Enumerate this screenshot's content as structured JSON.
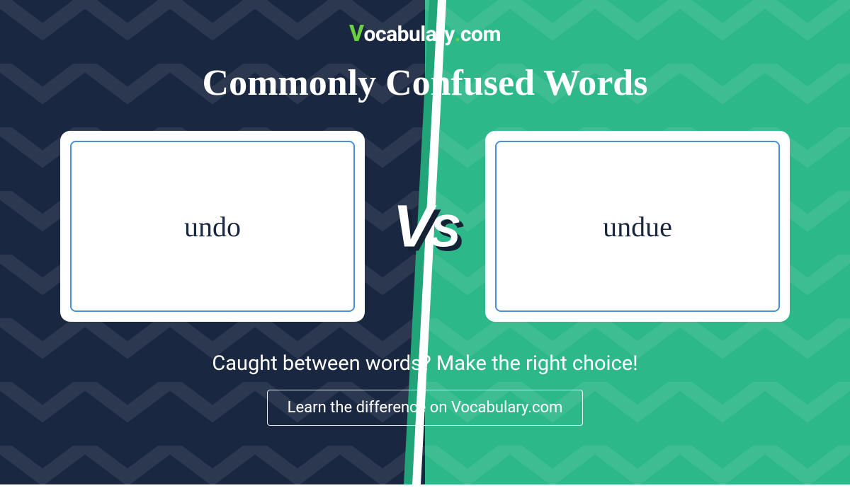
{
  "logo": {
    "text_v": "V",
    "text_rest": "ocabulary",
    "text_dot": ".",
    "text_com": "com"
  },
  "title": "Commonly Confused Words",
  "card_left": {
    "word": "undo"
  },
  "card_right": {
    "word": "undue"
  },
  "vs": {
    "v": "V",
    "s": "S"
  },
  "tagline": "Caught between words? Make the right choice!",
  "cta": "Learn the difference on Vocabulary.com",
  "colors": {
    "navy": "#1a2740",
    "teal": "#2db88a",
    "accent_green": "#6bcf3f",
    "card_border": "#4a8fd8"
  }
}
